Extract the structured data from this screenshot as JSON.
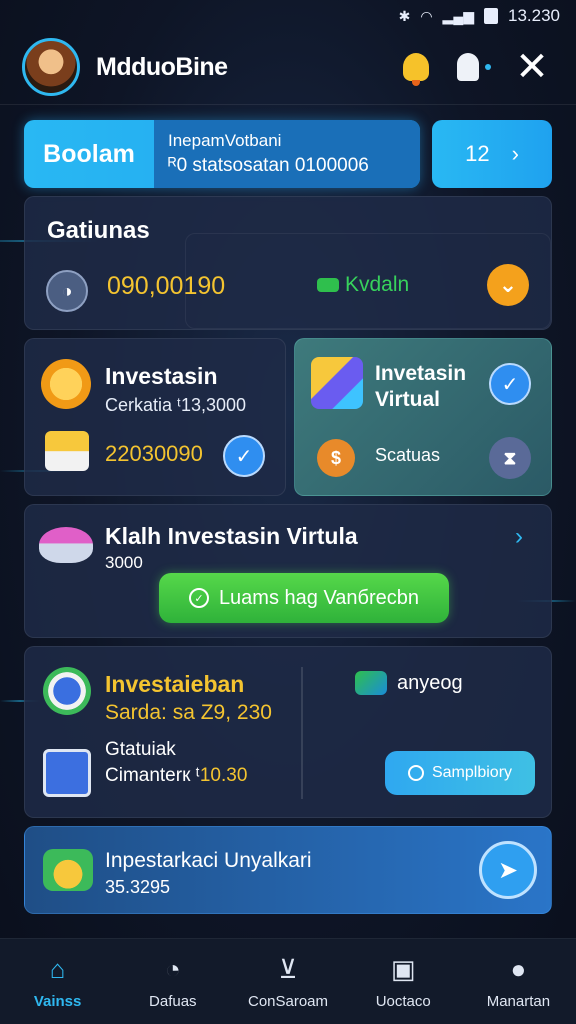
{
  "status_bar": {
    "time": "13.230"
  },
  "header": {
    "title": "MdduoBine"
  },
  "tabs": {
    "main_label": "Boolam",
    "info_line1": "InepamVotbani",
    "info_line2": "ᴿ0 statsosatan  0100006",
    "side_label": "12"
  },
  "card_balance": {
    "title": "Gatiunas",
    "value": "090,00190",
    "tag": "Kvdaln"
  },
  "card_investasi": {
    "title": "Investasin",
    "subtitle": "Cerkatia  ᵗ13,3000",
    "value": "22030090"
  },
  "card_virtual": {
    "title_line1": "Invetasin",
    "title_line2": "Virtual",
    "status": "Scatuas"
  },
  "card_klaim": {
    "title": "Klalh Investasin Virtula",
    "subtitle": "3000",
    "button": "Luams hag Vanбrecbn"
  },
  "card_investaieban": {
    "title": "Investaieban",
    "subtitle": "Sarda: sa Z9, 230",
    "tag": "anyeog",
    "line1": "Gtatuiak",
    "line2_prefix": "Cimanterк ᵗ",
    "line2_value": "10.30",
    "button": "Samplbiory"
  },
  "card_unyalkari": {
    "title": "Inpestarkaci Unyalkari",
    "value": "35.3295"
  },
  "nav": [
    {
      "label": "Vainss",
      "icon": "home-icon"
    },
    {
      "label": "Dafuas",
      "icon": "chat-icon"
    },
    {
      "label": "ConSaroam",
      "icon": "hanger-icon"
    },
    {
      "label": "Uoctaco",
      "icon": "receipt-icon"
    },
    {
      "label": "Manartan",
      "icon": "profile-icon"
    }
  ],
  "colors": {
    "accent": "#2fb8f0",
    "gold": "#f4c430",
    "green": "#37d25c",
    "background": "#0e1526"
  }
}
